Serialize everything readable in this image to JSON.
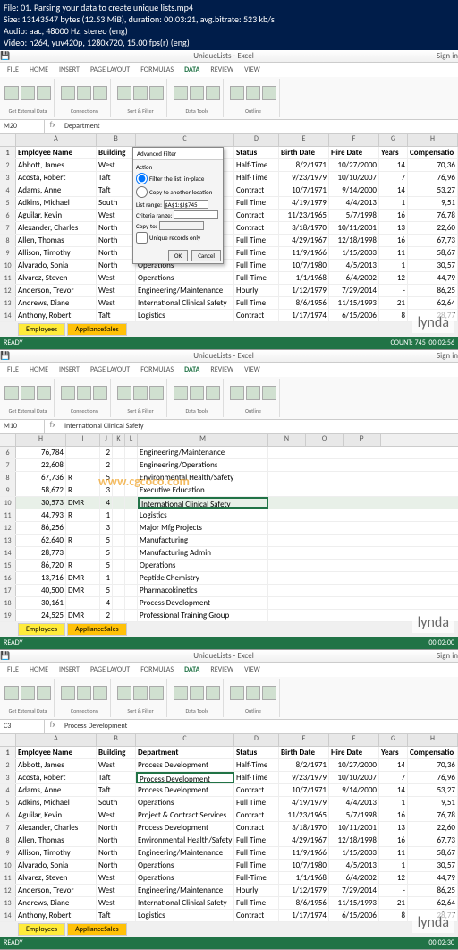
{
  "fileHeader": {
    "line1": "File: 01. Parsing your data to create unique lists.mp4",
    "line2": "Size: 13143547 bytes (12.53 MiB), duration: 00:03:21, avg.bitrate: 523 kb/s",
    "line3": "Audio: aac, 48000 Hz, stereo (eng)",
    "line4": "Video: h264, yuv420p, 1280x720, 15.00 fps(r) (eng)"
  },
  "logo": {
    "lynda": "lynda",
    ".com": ".com"
  },
  "watermark": "www.cgcoco.com",
  "excel": {
    "windowTitle": "UniqueLists - Excel",
    "menus": [
      "FILE",
      "HOME",
      "INSERT",
      "PAGE LAYOUT",
      "FORMULAS",
      "DATA",
      "REVIEW",
      "VIEW"
    ],
    "signIn": "Sign in",
    "ribbonGroups": [
      "Get External Data",
      "Connections",
      "Sort & Filter",
      "Data Tools",
      "Outline"
    ],
    "sheetTabs": {
      "emp": "Employees",
      "app": "ApplianceSales"
    },
    "status": {
      "ready": "READY",
      "count": "COUNT: 745"
    }
  },
  "s1": {
    "nameBox": "M20",
    "formula": "Department",
    "selectedCol": "C",
    "colHeads": [
      "A",
      "B",
      "C",
      "D",
      "E",
      "F",
      "G",
      "H"
    ],
    "headers": [
      "Employee Name",
      "Building",
      "Department",
      "Status",
      "Birth Date",
      "Hire Date",
      "Years",
      "Compensatio"
    ],
    "timestamp": "00:02:56",
    "advFilter": {
      "title": "Advanced Filter",
      "action": "Action",
      "opt1": "Filter the list, in-place",
      "opt2": "Copy to another location",
      "listRange": "List range:",
      "listVal": "$A$1:$J$745",
      "critRange": "Criteria range:",
      "copyTo": "Copy to:",
      "unique": "Unique records only",
      "ok": "OK",
      "cancel": "Cancel"
    },
    "rows": [
      {
        "n": "1",
        "a": "Employee Name",
        "b": "Building",
        "c": "Department",
        "d": "Status",
        "e": "Birth Date",
        "f": "Hire Date",
        "g": "Years",
        "h": "Compensatio",
        "hdr": true
      },
      {
        "n": "2",
        "a": "Abbott, James",
        "b": "West",
        "c": "Process Development",
        "d": "Half-Time",
        "e": "8/2/1971",
        "f": "10/27/2000",
        "g": "14",
        "h": "70,36"
      },
      {
        "n": "3",
        "a": "Acosta, Robert",
        "b": "Taft",
        "c": "Process D",
        "d": "Half-Time",
        "e": "9/23/1979",
        "f": "10/10/2007",
        "g": "7",
        "h": "76,96"
      },
      {
        "n": "4",
        "a": "Adams, Anne",
        "b": "Taft",
        "c": "Process D",
        "d": "Contract",
        "e": "10/7/1971",
        "f": "9/14/2000",
        "g": "14",
        "h": "53,27"
      },
      {
        "n": "5",
        "a": "Adkins, Michael",
        "b": "South",
        "c": "Operation",
        "d": "Full Time",
        "e": "4/19/1979",
        "f": "4/4/2013",
        "g": "1",
        "h": "9,51"
      },
      {
        "n": "6",
        "a": "Aguilar, Kevin",
        "b": "West",
        "c": "Project &",
        "d": "Contract",
        "e": "11/23/1965",
        "f": "5/7/1998",
        "g": "16",
        "h": "76,78"
      },
      {
        "n": "7",
        "a": "Alexander, Charles",
        "b": "North",
        "c": "Process D",
        "d": "Contract",
        "e": "3/18/1970",
        "f": "10/11/2001",
        "g": "13",
        "h": "22,60"
      },
      {
        "n": "8",
        "a": "Allen, Thomas",
        "b": "North",
        "c": "Environm",
        "d": "Full Time",
        "e": "4/29/1967",
        "f": "12/18/1998",
        "g": "16",
        "h": "67,73"
      },
      {
        "n": "9",
        "a": "Allison, Timothy",
        "b": "North",
        "c": "Engineering/Maintenance",
        "d": "Full Time",
        "e": "11/9/1966",
        "f": "1/15/2003",
        "g": "11",
        "h": "58,67"
      },
      {
        "n": "10",
        "a": "Alvarado, Sonia",
        "b": "North",
        "c": "Operations",
        "d": "Full Time",
        "e": "10/7/1980",
        "f": "4/5/2013",
        "g": "1",
        "h": "30,57"
      },
      {
        "n": "11",
        "a": "Alvarez, Steven",
        "b": "West",
        "c": "Operations",
        "d": "Full-Time",
        "e": "1/1/1968",
        "f": "6/4/2002",
        "g": "12",
        "h": "44,79"
      },
      {
        "n": "12",
        "a": "Anderson, Trevor",
        "b": "West",
        "c": "Engineering/Maintenance",
        "d": "Hourly",
        "e": "1/12/1979",
        "f": "7/29/2014",
        "g": "-",
        "h": "86,25"
      },
      {
        "n": "13",
        "a": "Andrews, Diane",
        "b": "West",
        "c": "International Clinical Safety",
        "d": "Full Time",
        "e": "8/6/1956",
        "f": "11/15/1993",
        "g": "21",
        "h": "62,64"
      },
      {
        "n": "14",
        "a": "Anthony, Robert",
        "b": "Taft",
        "c": "Logistics",
        "d": "Contract",
        "e": "1/17/1974",
        "f": "6/15/2006",
        "g": "8",
        "h": "28,77"
      }
    ]
  },
  "s2": {
    "nameBox": "M10",
    "formula": "International Clinical Safety",
    "timestamp": "00:02:00",
    "colHeads": [
      "H",
      "I",
      "J",
      "K",
      "L",
      "M",
      "N",
      "O",
      "P"
    ],
    "rows": [
      {
        "n": "6",
        "h": "76,784",
        "i": "",
        "j": "2",
        "k": "",
        "l": "",
        "m": "Engineering/Maintenance"
      },
      {
        "n": "7",
        "h": "22,608",
        "i": "",
        "j": "2",
        "k": "",
        "l": "",
        "m": "Engineering/Operations"
      },
      {
        "n": "8",
        "h": "67,736",
        "i": "R",
        "j": "5",
        "k": "",
        "l": "",
        "m": "Environmental Health/Safety"
      },
      {
        "n": "9",
        "h": "58,672",
        "i": "R",
        "j": "3",
        "k": "",
        "l": "",
        "m": "Executive Education"
      },
      {
        "n": "10",
        "h": "30,573",
        "i": "DMR",
        "j": "4",
        "k": "",
        "l": "",
        "m": "International Clinical Safety",
        "sel": true
      },
      {
        "n": "11",
        "h": "44,793",
        "i": "R",
        "j": "1",
        "k": "",
        "l": "",
        "m": "Logistics"
      },
      {
        "n": "12",
        "h": "86,256",
        "i": "",
        "j": "3",
        "k": "",
        "l": "",
        "m": "Major Mfg Projects"
      },
      {
        "n": "13",
        "h": "62,640",
        "i": "R",
        "j": "5",
        "k": "",
        "l": "",
        "m": "Manufacturing"
      },
      {
        "n": "14",
        "h": "28,773",
        "i": "",
        "j": "5",
        "k": "",
        "l": "",
        "m": "Manufacturing Admin"
      },
      {
        "n": "15",
        "h": "86,720",
        "i": "R",
        "j": "5",
        "k": "",
        "l": "",
        "m": "Operations"
      },
      {
        "n": "16",
        "h": "13,716",
        "i": "DMR",
        "j": "1",
        "k": "",
        "l": "",
        "m": "Peptide Chemistry"
      },
      {
        "n": "17",
        "h": "40,500",
        "i": "DMR",
        "j": "5",
        "k": "",
        "l": "",
        "m": "Pharmacokinetics"
      },
      {
        "n": "18",
        "h": "30,161",
        "i": "",
        "j": "4",
        "k": "",
        "l": "",
        "m": "Process Development"
      },
      {
        "n": "19",
        "h": "24,525",
        "i": "DMR",
        "j": "2",
        "k": "",
        "l": "",
        "m": "Professional Training Group"
      }
    ]
  },
  "s3": {
    "nameBox": "C3",
    "formula": "Process Development",
    "timestamp": "00:02:30",
    "colHeads": [
      "A",
      "B",
      "C",
      "D",
      "E",
      "F",
      "G",
      "H"
    ],
    "rows": [
      {
        "n": "1",
        "a": "Employee Name",
        "b": "Building",
        "c": "Department",
        "d": "Status",
        "e": "Birth Date",
        "f": "Hire Date",
        "g": "Years",
        "h": "Compensatio",
        "hdr": true
      },
      {
        "n": "2",
        "a": "Abbott, James",
        "b": "West",
        "c": "Process Development",
        "d": "Half-Time",
        "e": "8/2/1971",
        "f": "10/27/2000",
        "g": "14",
        "h": "70,36"
      },
      {
        "n": "3",
        "a": "Acosta, Robert",
        "b": "Taft",
        "c": "Process Development",
        "d": "Half-Time",
        "e": "9/23/1979",
        "f": "10/10/2007",
        "g": "7",
        "h": "76,96",
        "sel": true
      },
      {
        "n": "4",
        "a": "Adams, Anne",
        "b": "Taft",
        "c": "Process Development",
        "d": "Contract",
        "e": "10/7/1971",
        "f": "9/14/2000",
        "g": "14",
        "h": "53,27"
      },
      {
        "n": "5",
        "a": "Adkins, Michael",
        "b": "South",
        "c": "Operations",
        "d": "Full Time",
        "e": "4/19/1979",
        "f": "4/4/2013",
        "g": "1",
        "h": "9,51"
      },
      {
        "n": "6",
        "a": "Aguilar, Kevin",
        "b": "West",
        "c": "Project & Contract Services",
        "d": "Contract",
        "e": "11/23/1965",
        "f": "5/7/1998",
        "g": "16",
        "h": "76,78"
      },
      {
        "n": "7",
        "a": "Alexander, Charles",
        "b": "North",
        "c": "Process Development",
        "d": "Contract",
        "e": "3/18/1970",
        "f": "10/11/2001",
        "g": "13",
        "h": "22,60"
      },
      {
        "n": "8",
        "a": "Allen, Thomas",
        "b": "North",
        "c": "Environmental Health/Safety",
        "d": "Full Time",
        "e": "4/29/1967",
        "f": "12/18/1998",
        "g": "16",
        "h": "67,73"
      },
      {
        "n": "9",
        "a": "Allison, Timothy",
        "b": "North",
        "c": "Engineering/Maintenance",
        "d": "Full Time",
        "e": "11/9/1966",
        "f": "1/15/2003",
        "g": "11",
        "h": "58,67"
      },
      {
        "n": "10",
        "a": "Alvarado, Sonia",
        "b": "North",
        "c": "Operations",
        "d": "Full Time",
        "e": "10/7/1980",
        "f": "4/5/2013",
        "g": "1",
        "h": "30,57"
      },
      {
        "n": "11",
        "a": "Alvarez, Steven",
        "b": "West",
        "c": "Operations",
        "d": "Full-Time",
        "e": "1/1/1968",
        "f": "6/4/2002",
        "g": "12",
        "h": "44,79"
      },
      {
        "n": "12",
        "a": "Anderson, Trevor",
        "b": "West",
        "c": "Engineering/Maintenance",
        "d": "Hourly",
        "e": "1/12/1979",
        "f": "7/29/2014",
        "g": "-",
        "h": "86,25"
      },
      {
        "n": "13",
        "a": "Andrews, Diane",
        "b": "West",
        "c": "International Clinical Safety",
        "d": "Full Time",
        "e": "8/6/1956",
        "f": "11/15/1993",
        "g": "21",
        "h": "62,64"
      },
      {
        "n": "14",
        "a": "Anthony, Robert",
        "b": "Taft",
        "c": "Logistics",
        "d": "Contract",
        "e": "1/17/1974",
        "f": "6/15/2006",
        "g": "8",
        "h": "28,77"
      }
    ]
  }
}
